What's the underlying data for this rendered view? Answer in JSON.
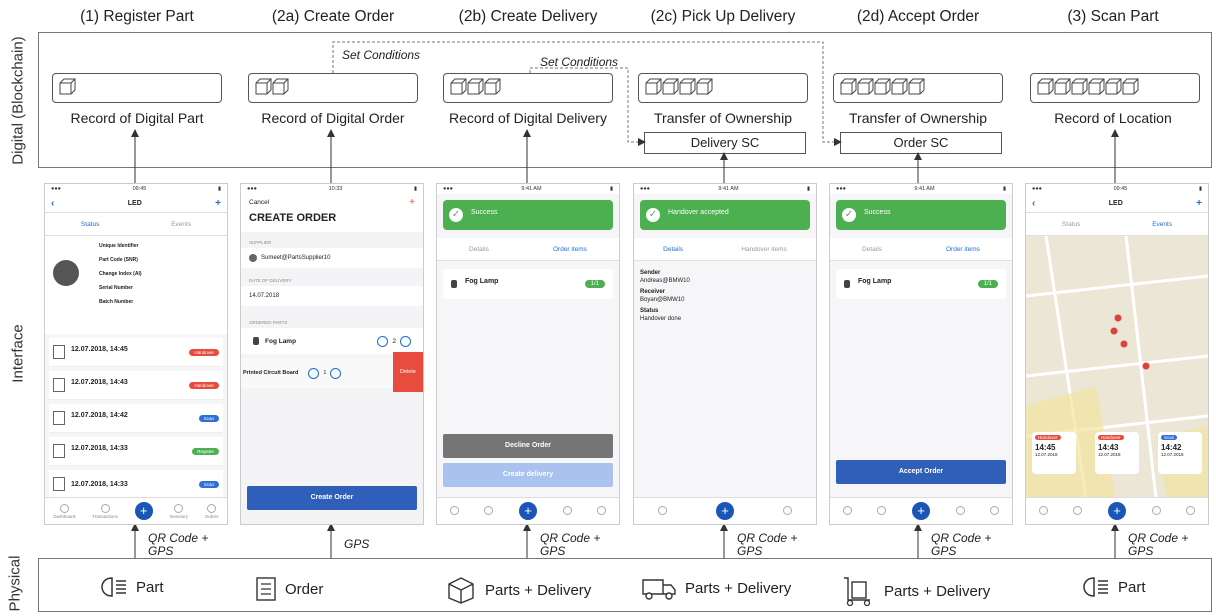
{
  "steps": [
    {
      "title": "(1) Register Part",
      "record": "Record of Digital Part"
    },
    {
      "title": "(2a) Create Order",
      "record": "Record of Digital Order"
    },
    {
      "title": "(2b) Create Delivery",
      "record": "Record of Digital Delivery"
    },
    {
      "title": "(2c) Pick Up Delivery",
      "record": "Transfer of Ownership",
      "sc": "Delivery SC"
    },
    {
      "title": "(2d) Accept Order",
      "record": "Transfer of Ownership",
      "sc": "Order SC"
    },
    {
      "title": "(3) Scan Part",
      "record": "Record of Location"
    }
  ],
  "bands": {
    "digital": "Digital (Blockchain)",
    "interface": "Interface",
    "physical": "Physical"
  },
  "set_conditions": [
    "Set Conditions",
    "Set Conditions"
  ],
  "arrow_labels": [
    "QR Code + GPS",
    "GPS",
    "QR Code + GPS",
    "QR Code + GPS",
    "QR Code + GPS",
    "QR Code + GPS"
  ],
  "physical_items": [
    "Part",
    "Order",
    "Parts + Delivery",
    "Parts + Delivery",
    "Parts + Delivery",
    "Part"
  ],
  "phone1": {
    "time": "09:45",
    "title": "LED",
    "tab_status": "Status",
    "tab_events": "Events",
    "unique_id_label": "Unique Identifier",
    "part_code_label": "Part Code (SNR)",
    "change_index_label": "Change Index (AI)",
    "serial_label": "Serial Number",
    "batch_label": "Batch Number",
    "history": [
      {
        "date": "12.07.2018, 14:45",
        "pill": "Handover",
        "color": "#e74c3c"
      },
      {
        "date": "12.07.2018, 14:43",
        "pill": "Handover",
        "color": "#e74c3c"
      },
      {
        "date": "12.07.2018, 14:42",
        "pill": "Scan",
        "color": "#2f6fd6"
      },
      {
        "date": "12.07.2018, 14:33",
        "pill": "Register",
        "color": "#4caf50"
      },
      {
        "date": "12.07.2018, 14:33",
        "pill": "Scan",
        "color": "#2f6fd6"
      }
    ],
    "tabbar": [
      "Dashboard",
      "Transactions",
      "",
      "Inventory",
      "Orders"
    ]
  },
  "phone2": {
    "cancel": "Cancel",
    "title": "CREATE ORDER",
    "supplier_label": "SUPPLIER",
    "supplier": "Sumeet@PartsSupplier10",
    "date_label": "DATE OF DELIVERY",
    "date": "14.07.2018",
    "parts_label": "ORDERED PARTS",
    "part1": "Fog Lamp",
    "part1_qty": "2",
    "part2": "Printed Circuit Board",
    "part2_qty": "1",
    "delete": "Delete",
    "button": "Create Order"
  },
  "phone3": {
    "time": "9:41 AM",
    "banner_title": "Success",
    "tab_details": "Details",
    "tab_items": "Order items",
    "item": "Fog Lamp",
    "qty": "1/1",
    "decline": "Decline Order",
    "create": "Create delivery"
  },
  "phone4": {
    "time": "9:41 AM",
    "banner_title": "Handover accepted",
    "tab_details": "Details",
    "tab_items": "Handover items",
    "sender_label": "Sender",
    "sender": "Andreas@BMW10",
    "receiver_label": "Receiver",
    "receiver": "Boyan@BMW10",
    "status_label": "Status",
    "status": "Handover done"
  },
  "phone5": {
    "time": "9:41 AM",
    "banner_title": "Success",
    "tab_details": "Details",
    "tab_items": "Order items",
    "item": "Fog Lamp",
    "qty": "1/1",
    "button": "Accept Order"
  },
  "phone6": {
    "time": "09:45",
    "title": "LED",
    "tab_status": "Status",
    "tab_events": "Events",
    "cards": [
      {
        "pill": "Handover",
        "color": "#e74c3c",
        "time": "14:45",
        "date": "12.07.2018"
      },
      {
        "pill": "Handover",
        "color": "#e74c3c",
        "time": "14:43",
        "date": "12.07.2018"
      },
      {
        "pill": "Scan",
        "color": "#2f6fd6",
        "time": "14:42",
        "date": "12.07.2018"
      }
    ]
  }
}
